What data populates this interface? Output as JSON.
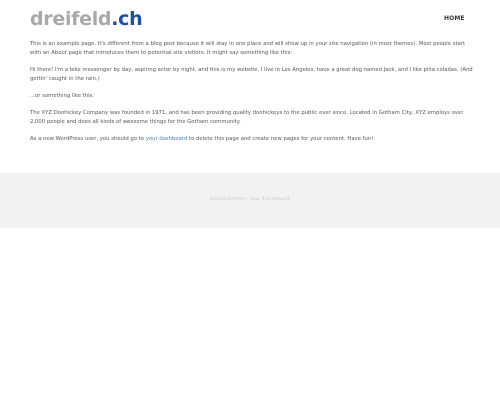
{
  "header": {
    "logo_main": "dreifeld",
    "logo_tld": ".ch",
    "nav": {
      "home_label": "HOME"
    }
  },
  "content": {
    "p1": "This is an example page. It's different from a blog post because it will stay in one place and will show up in your site navigation (in most themes). Most people start with an About page that introduces them to potential site visitors. It might say something like this:",
    "p2": "Hi there! I'm a bike messenger by day, aspiring actor by night, and this is my website. I live in Los Angeles, have a great dog named Jack, and I like piña coladas. (And gettin' caught in the rain.)",
    "p3": "...or something like this:",
    "p4": "The XYZ Doohickey Company was founded in 1971, and has been providing quality doohickeys to the public ever since. Located in Gotham City, XYZ employs over 2,000 people and does all kinds of awesome things for the Gotham community.",
    "p5_before": "As a new WordPress user, you should go to ",
    "p5_link": "your dashboard",
    "p5_after": " to delete this page and create new pages for your content. Have fun!"
  },
  "footer": {
    "text": "©2023 Dreifeld • Your first network"
  },
  "colors": {
    "logo_gray": "#a9a9a9",
    "logo_blue": "#1f4fa3",
    "link": "#4a7bbf",
    "footer_bg": "#f2f2f2"
  }
}
